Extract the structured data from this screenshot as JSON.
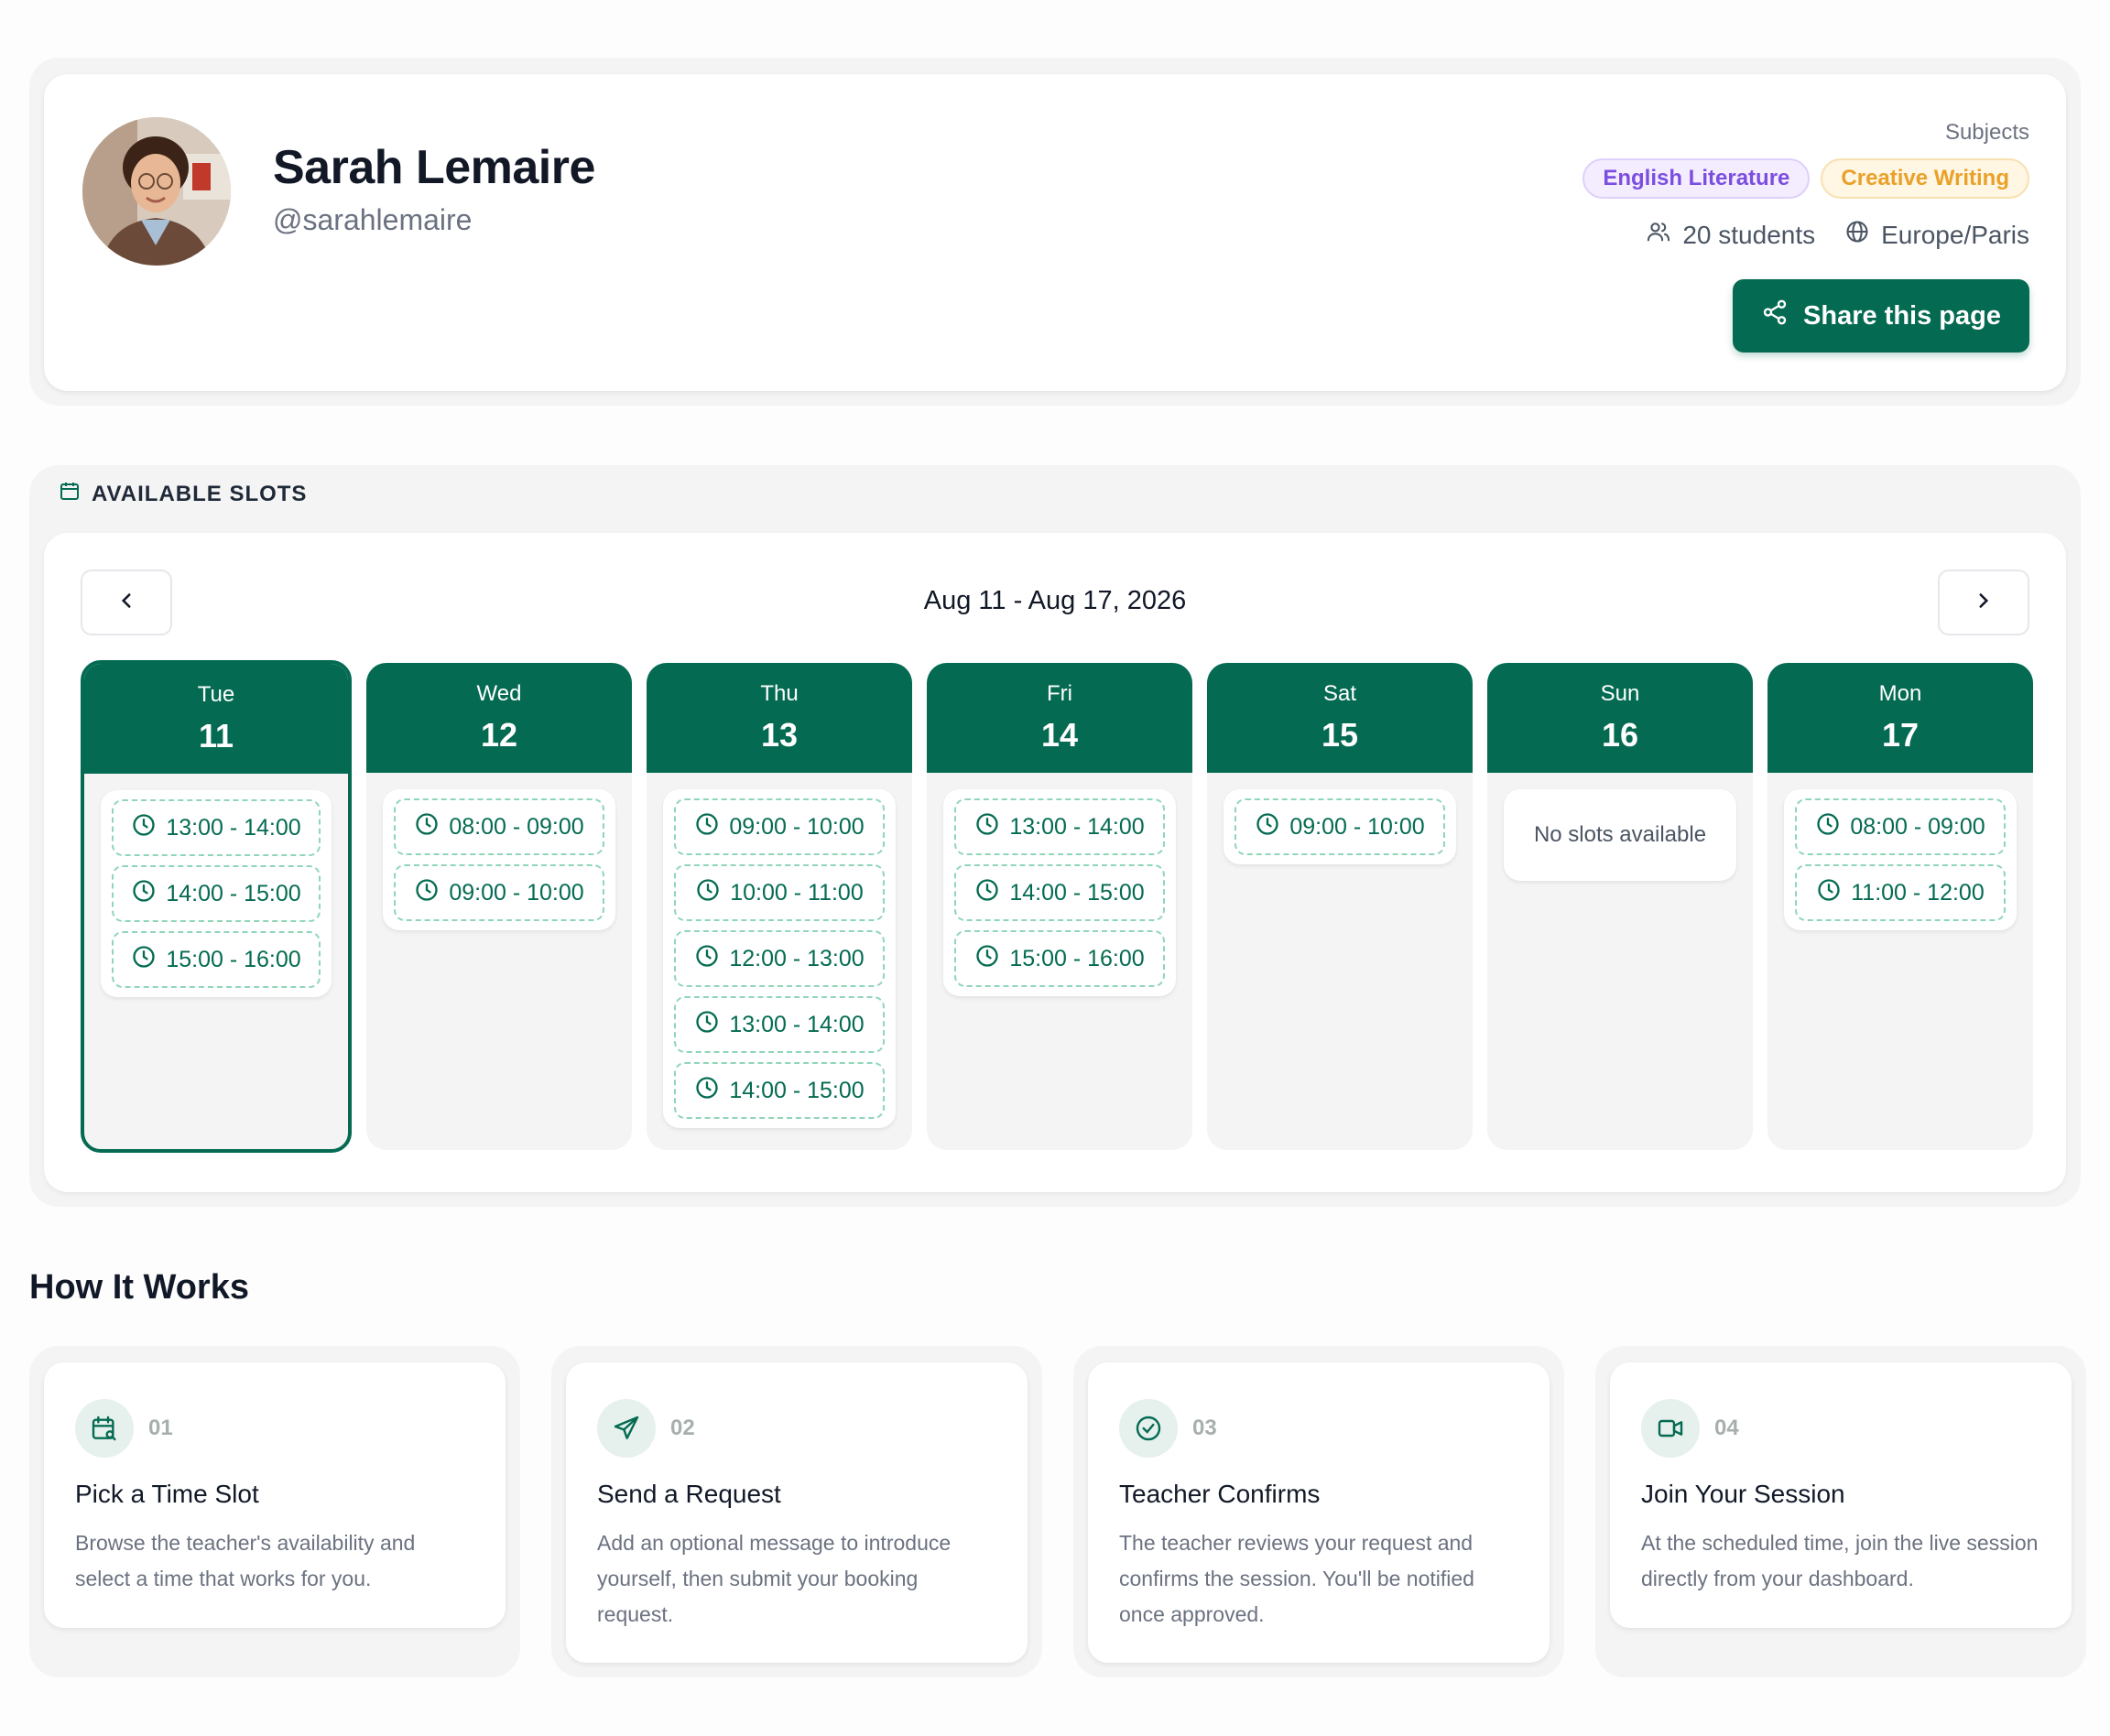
{
  "profile": {
    "name": "Sarah Lemaire",
    "handle": "@sarahlemaire",
    "subjects_label": "Subjects",
    "subjects": [
      {
        "label": "English Literature",
        "color": "#7c4ee0"
      },
      {
        "label": "Creative Writing",
        "color": "#e9a12a"
      }
    ],
    "students": "20 students",
    "timezone": "Europe/Paris",
    "share_label": "Share this page"
  },
  "slots": {
    "title": "AVAILABLE SLOTS",
    "range": "Aug 11 - Aug 17, 2026",
    "days": [
      {
        "name": "Tue",
        "num": "11",
        "selected": true,
        "slots": [
          "13:00 - 14:00",
          "14:00 - 15:00",
          "15:00 - 16:00"
        ]
      },
      {
        "name": "Wed",
        "num": "12",
        "slots": [
          "08:00 - 09:00",
          "09:00 - 10:00"
        ]
      },
      {
        "name": "Thu",
        "num": "13",
        "slots": [
          "09:00 - 10:00",
          "10:00 - 11:00",
          "12:00 - 13:00",
          "13:00 - 14:00",
          "14:00 - 15:00"
        ]
      },
      {
        "name": "Fri",
        "num": "14",
        "slots": [
          "13:00 - 14:00",
          "14:00 - 15:00",
          "15:00 - 16:00"
        ]
      },
      {
        "name": "Sat",
        "num": "15",
        "slots": [
          "09:00 - 10:00"
        ]
      },
      {
        "name": "Sun",
        "num": "16",
        "slots": [],
        "empty_label": "No slots available"
      },
      {
        "name": "Mon",
        "num": "17",
        "slots": [
          "08:00 - 09:00",
          "11:00 - 12:00"
        ]
      }
    ]
  },
  "how": {
    "title": "How It Works",
    "steps": [
      {
        "num": "01",
        "icon": "calendar-search-icon",
        "title": "Pick a Time Slot",
        "desc": "Browse the teacher's availability and select a time that works for you."
      },
      {
        "num": "02",
        "icon": "send-icon",
        "title": "Send a Request",
        "desc": "Add an optional message to introduce yourself, then submit your booking request."
      },
      {
        "num": "03",
        "icon": "check-circle-icon",
        "title": "Teacher Confirms",
        "desc": "The teacher reviews your request and confirms the session. You'll be notified once approved."
      },
      {
        "num": "04",
        "icon": "video-icon",
        "title": "Join Your Session",
        "desc": "At the scheduled time, join the live session directly from your dashboard."
      }
    ]
  },
  "colors": {
    "primary": "#046b52",
    "slot_border": "#8fd6b8"
  }
}
